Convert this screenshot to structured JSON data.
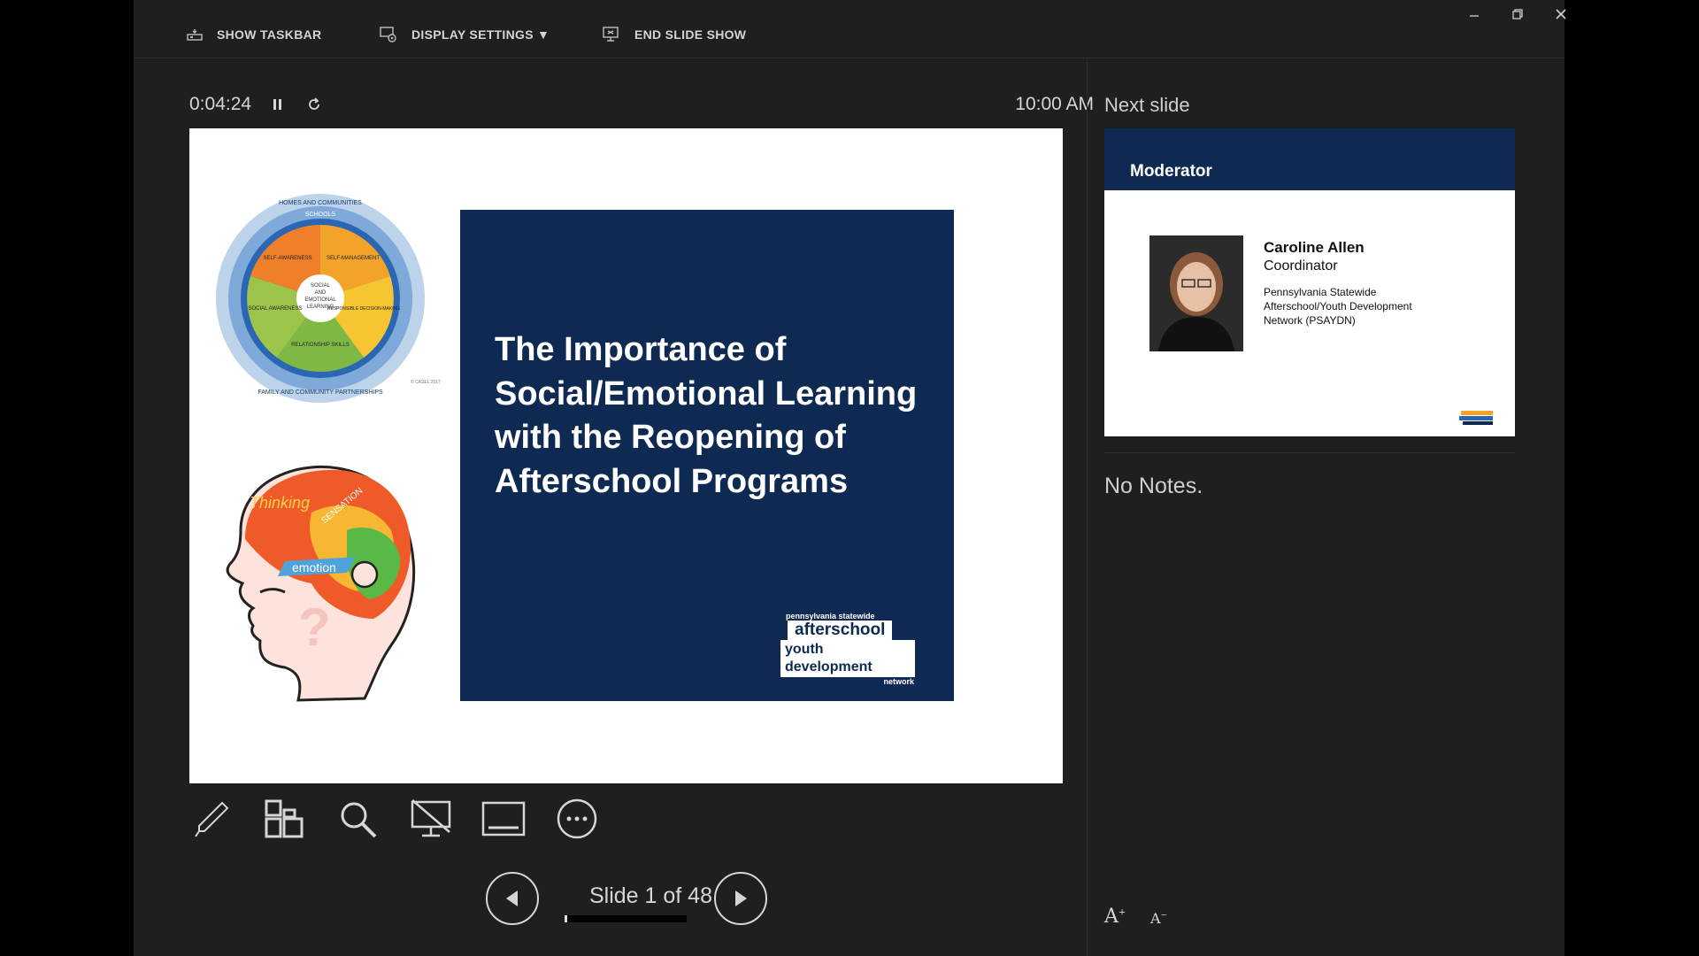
{
  "toolbar": {
    "show_taskbar": "SHOW TASKBAR",
    "display_settings": "DISPLAY SETTINGS ▼",
    "end_slide_show": "END SLIDE SHOW"
  },
  "window_controls": [
    "minimize-icon",
    "restore-icon",
    "close-icon"
  ],
  "presenter": {
    "elapsed_time": "0:04:24",
    "clock": "10:00 AM",
    "pause_icon": "pause-icon",
    "restart_icon": "restart-icon"
  },
  "current_slide": {
    "title": "The Importance of Social/Emotional Learning with the Reopening of Afterschool Programs",
    "logo": {
      "top": "pennsylvania statewide",
      "line1": "afterschool",
      "line2": "youth development",
      "bottom": "network"
    },
    "sel_wheel": {
      "outer_ring": "HOMES AND COMMUNITIES",
      "middle_ring": "SCHOOLS",
      "segments": [
        "SELF-AWARENESS",
        "SELF-MANAGEMENT",
        "RESPONSIBLE DECISION-MAKING",
        "RELATIONSHIP SKILLS",
        "SOCIAL AWARENESS"
      ],
      "center": [
        "SOCIAL",
        "AND",
        "EMOTIONAL",
        "LEARNING"
      ],
      "bottom_ring": "FAMILY AND COMMUNITY PARTNERSHIPS",
      "credit": "© CASEL 2017"
    },
    "head_words": [
      "Thinking",
      "emotion",
      "SENSATION"
    ]
  },
  "tools": [
    "pen-icon",
    "all-slides-icon",
    "zoom-icon",
    "black-screen-icon",
    "subtitles-icon",
    "more-options-icon"
  ],
  "navigation": {
    "slide_counter": "Slide 1 of 48",
    "progress_fraction": 0.0208
  },
  "next_slide": {
    "label": "Next slide",
    "title": "Moderator",
    "name": "Caroline Allen",
    "role": "Coordinator",
    "organization": "Pennsylvania Statewide Afterschool/Youth Development Network (PSAYDN)"
  },
  "notes": {
    "text": "No Notes."
  },
  "font_controls": [
    "increase-font-icon",
    "decrease-font-icon"
  ],
  "colors": {
    "slide_navy": "#0f2a52",
    "panel_bg": "#1f1f1f"
  }
}
